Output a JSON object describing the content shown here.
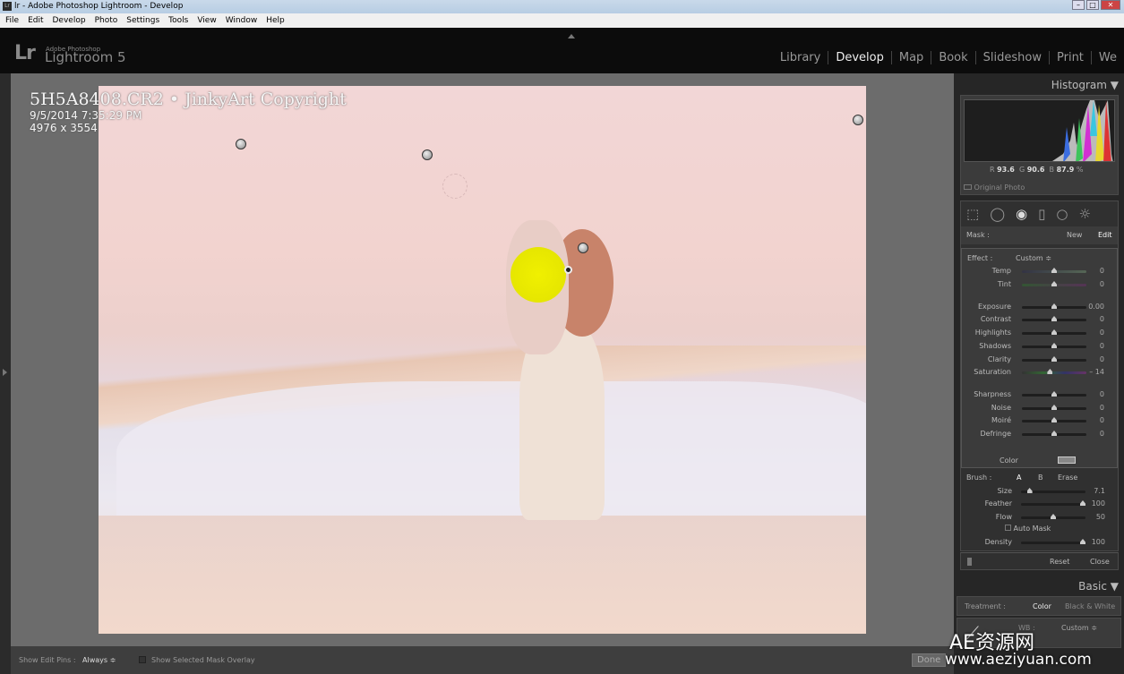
{
  "window": {
    "title": "lr - Adobe Photoshop Lightroom - Develop",
    "app_icon": "Lr"
  },
  "menu": [
    "File",
    "Edit",
    "Develop",
    "Photo",
    "Settings",
    "Tools",
    "View",
    "Window",
    "Help"
  ],
  "logo": {
    "mark": "Lr",
    "sub": "Adobe Photoshop",
    "name": "Lightroom 5"
  },
  "modules": [
    {
      "label": "Library"
    },
    {
      "label": "Develop",
      "active": true
    },
    {
      "label": "Map"
    },
    {
      "label": "Book"
    },
    {
      "label": "Slideshow"
    },
    {
      "label": "Print"
    },
    {
      "label": "We"
    }
  ],
  "photo_info": {
    "filename": "5H5A8408.CR2 • JinkyArt Copyright",
    "datetime": "9/5/2014 7:35:29 PM",
    "dimensions": "4976 x 3554"
  },
  "histogram": {
    "title": "Histogram",
    "r_label": "R",
    "r": "93.6",
    "g_label": "G",
    "g": "90.6",
    "b_label": "B",
    "b": "87.9",
    "unit": "%",
    "original_photo": "Original Photo"
  },
  "mask": {
    "label": "Mask :",
    "new": "New",
    "edit": "Edit"
  },
  "effect": {
    "label": "Effect :",
    "preset": "Custom ≑",
    "sliders": [
      {
        "name": "Temp",
        "value": "0",
        "pos": 0.5
      },
      {
        "name": "Tint",
        "value": "0",
        "pos": 0.5
      },
      {
        "name": "Exposure",
        "value": "0.00",
        "pos": 0.5
      },
      {
        "name": "Contrast",
        "value": "0",
        "pos": 0.5
      },
      {
        "name": "Highlights",
        "value": "0",
        "pos": 0.5
      },
      {
        "name": "Shadows",
        "value": "0",
        "pos": 0.5
      },
      {
        "name": "Clarity",
        "value": "0",
        "pos": 0.5
      },
      {
        "name": "Saturation",
        "value": "– 14",
        "pos": 0.43
      },
      {
        "name": "Sharpness",
        "value": "0",
        "pos": 0.5
      },
      {
        "name": "Noise",
        "value": "0",
        "pos": 0.5
      },
      {
        "name": "Moiré",
        "value": "0",
        "pos": 0.5
      },
      {
        "name": "Defringe",
        "value": "0",
        "pos": 0.5
      }
    ],
    "color_label": "Color"
  },
  "brush": {
    "label": "Brush :",
    "a": "A",
    "b": "B",
    "erase": "Erase",
    "sliders": [
      {
        "name": "Size",
        "value": "7.1",
        "pos": 0.1
      },
      {
        "name": "Feather",
        "value": "100",
        "pos": 1
      },
      {
        "name": "Flow",
        "value": "50",
        "pos": 0.5
      }
    ],
    "auto_mask": "Auto Mask",
    "density": {
      "name": "Density",
      "value": "100",
      "pos": 1
    },
    "reset": "Reset",
    "close": "Close"
  },
  "basic": {
    "title": "Basic",
    "treatment_label": "Treatment :",
    "color": "Color",
    "bw": "Black & White",
    "wb_label": "WB :",
    "wb_value": "Custom ≑"
  },
  "toolbar": {
    "show_pins_label": "Show Edit Pins :",
    "show_pins_value": "Always ≑",
    "overlay_label": "Show Selected Mask Overlay",
    "done": "Done"
  },
  "watermark": {
    "line1": "AE资源网",
    "line2": "www.aeziyuan.com"
  }
}
